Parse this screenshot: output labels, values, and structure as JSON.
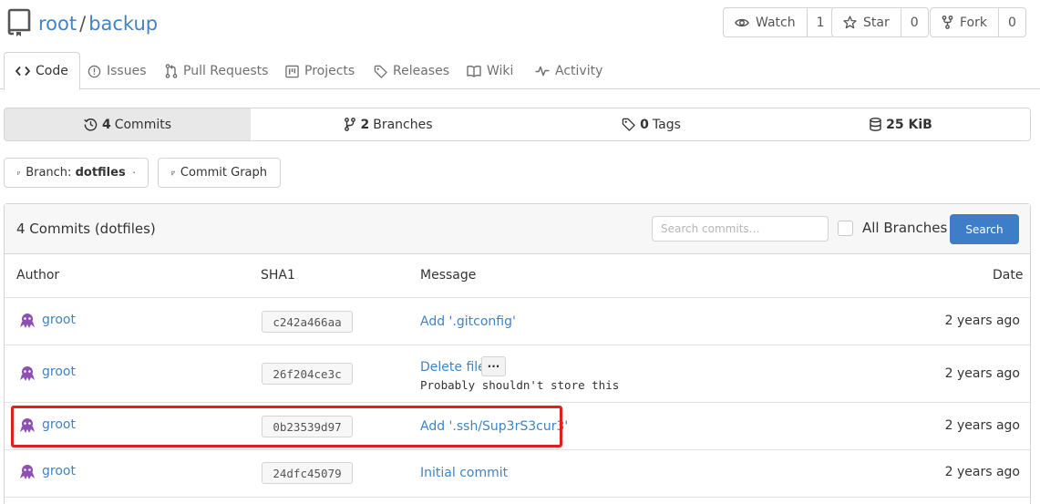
{
  "repo": {
    "owner": "root",
    "separator": "/",
    "name": "backup"
  },
  "header_buttons": [
    {
      "label": "Watch",
      "count": "1",
      "icon": "eye-icon"
    },
    {
      "label": "Star",
      "count": "0",
      "icon": "star-icon"
    },
    {
      "label": "Fork",
      "count": "0",
      "icon": "fork-icon"
    }
  ],
  "tabs": [
    {
      "label": "Code",
      "icon": "code-icon",
      "active": true
    },
    {
      "label": "Issues",
      "icon": "issue-icon"
    },
    {
      "label": "Pull Requests",
      "icon": "pull-request-icon"
    },
    {
      "label": "Projects",
      "icon": "project-icon"
    },
    {
      "label": "Releases",
      "icon": "tag-icon"
    },
    {
      "label": "Wiki",
      "icon": "book-icon"
    },
    {
      "label": "Activity",
      "icon": "pulse-icon"
    }
  ],
  "stats": [
    {
      "count": "4",
      "label": "Commits",
      "icon": "history-icon",
      "active": true
    },
    {
      "count": "2",
      "label": "Branches",
      "icon": "branch-icon"
    },
    {
      "count": "0",
      "label": "Tags",
      "icon": "tag-icon"
    },
    {
      "count": "25 KiB",
      "label": "",
      "icon": "database-icon"
    }
  ],
  "branch_button": {
    "prefix": "Branch:",
    "value": "dotfiles"
  },
  "commit_graph_label": "Commit Graph",
  "commits_panel": {
    "title": "4 Commits (dotfiles)",
    "search_placeholder": "Search commits…",
    "all_branches_label": "All Branches",
    "search_button": "Search",
    "columns": {
      "author": "Author",
      "sha": "SHA1",
      "message": "Message",
      "date": "Date"
    }
  },
  "commits": [
    {
      "author": "groot",
      "sha": "c242a466aa",
      "message": "Add '.gitconfig'",
      "date": "2 years ago"
    },
    {
      "author": "groot",
      "sha": "26f204ce3c",
      "message": "Delete file",
      "ellipsis": "···",
      "body": "Probably shouldn't store this",
      "date": "2 years ago"
    },
    {
      "author": "groot",
      "sha": "0b23539d97",
      "message": "Add '.ssh/Sup3rS3cur3'",
      "date": "2 years ago",
      "highlighted": true
    },
    {
      "author": "groot",
      "sha": "24dfc45079",
      "message": "Initial commit",
      "date": "2 years ago"
    }
  ],
  "colors": {
    "link": "#4183c4",
    "primary_button": "#3e7ec8",
    "highlight_border": "#e02020",
    "avatar": "#8e4fb0"
  }
}
